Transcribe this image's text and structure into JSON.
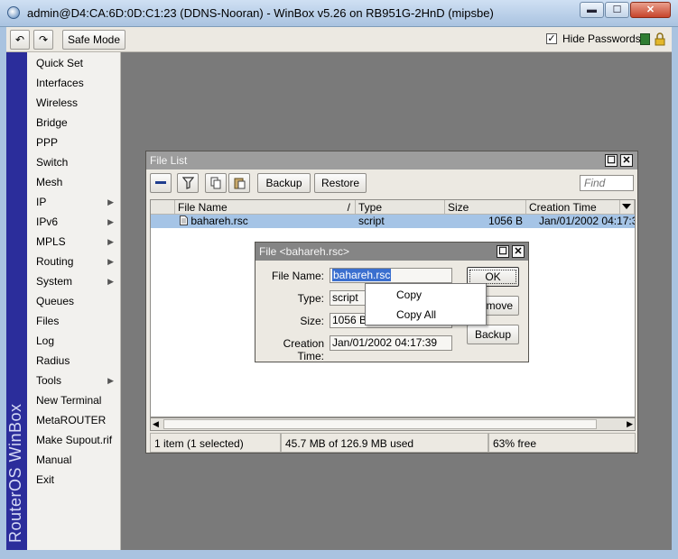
{
  "window": {
    "title": "admin@D4:CA:6D:0D:C1:23 (DDNS-Nooran) - WinBox v5.26 on RB951G-2HnD (mipsbe)",
    "minimize_glyph": "▬",
    "maximize_glyph": "☐",
    "close_glyph": "✕"
  },
  "toolbar": {
    "undo_glyph": "↶",
    "redo_glyph": "↷",
    "safe_mode": "Safe Mode",
    "hide_passwords_label": "Hide Passwords",
    "hide_passwords_checked": "✓",
    "status_color": "#2f7d32"
  },
  "brand": "RouterOS WinBox",
  "menu": {
    "items": [
      {
        "label": "Quick Set",
        "arrow": ""
      },
      {
        "label": "Interfaces",
        "arrow": ""
      },
      {
        "label": "Wireless",
        "arrow": ""
      },
      {
        "label": "Bridge",
        "arrow": ""
      },
      {
        "label": "PPP",
        "arrow": ""
      },
      {
        "label": "Switch",
        "arrow": ""
      },
      {
        "label": "Mesh",
        "arrow": ""
      },
      {
        "label": "IP",
        "arrow": "▶"
      },
      {
        "label": "IPv6",
        "arrow": "▶"
      },
      {
        "label": "MPLS",
        "arrow": "▶"
      },
      {
        "label": "Routing",
        "arrow": "▶"
      },
      {
        "label": "System",
        "arrow": "▶"
      },
      {
        "label": "Queues",
        "arrow": ""
      },
      {
        "label": "Files",
        "arrow": ""
      },
      {
        "label": "Log",
        "arrow": ""
      },
      {
        "label": "Radius",
        "arrow": ""
      },
      {
        "label": "Tools",
        "arrow": "▶"
      },
      {
        "label": "New Terminal",
        "arrow": ""
      },
      {
        "label": "MetaROUTER",
        "arrow": ""
      },
      {
        "label": "Make Supout.rif",
        "arrow": ""
      },
      {
        "label": "Manual",
        "arrow": ""
      },
      {
        "label": "Exit",
        "arrow": ""
      }
    ]
  },
  "file_list": {
    "title": "File List",
    "backup_label": "Backup",
    "restore_label": "Restore",
    "find_placeholder": "Find",
    "columns": [
      "File Name",
      "Type",
      "Size",
      "Creation Time"
    ],
    "sort_indicator": "/",
    "rows": [
      {
        "name": "bahareh.rsc",
        "type": "script",
        "size": "1056 B",
        "created": "Jan/01/2002 04:17:39"
      }
    ],
    "status": {
      "items": "1 item (1 selected)",
      "used": "45.7 MB of 126.9 MB used",
      "free": "63% free"
    },
    "scroll_left": "◀",
    "scroll_right": "▶"
  },
  "file_dialog": {
    "title": "File <bahareh.rsc>",
    "labels": {
      "name": "File Name:",
      "type": "Type:",
      "size": "Size:",
      "created": "Creation Time:"
    },
    "values": {
      "name": "bahareh.rsc",
      "type": "script",
      "size": "1056 B",
      "created": "Jan/01/2002 04:17:39"
    },
    "ok_label": "OK",
    "remove_label": "Remove",
    "remove_visible": "move",
    "backup_label": "Backup"
  },
  "context_menu": {
    "copy": "Copy",
    "copy_all": "Copy All"
  }
}
